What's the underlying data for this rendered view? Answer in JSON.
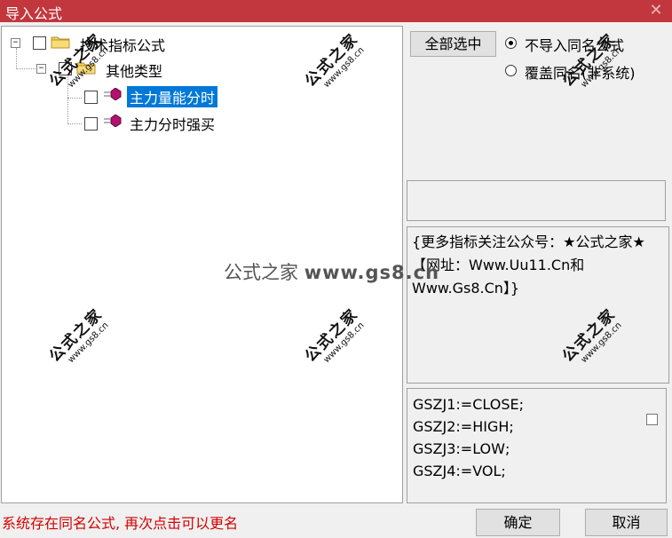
{
  "window": {
    "title": "导入公式",
    "close_glyph": "✕"
  },
  "tree": {
    "root": {
      "label": "技术指标公式",
      "expander": "−"
    },
    "group": {
      "label": "其他类型",
      "expander": "−"
    },
    "items": [
      {
        "label": "主力量能分时",
        "selected": true
      },
      {
        "label": "主力分时强买",
        "selected": false
      }
    ]
  },
  "buttons": {
    "select_all": "全部选中",
    "ok": "确定",
    "cancel": "取消"
  },
  "options": {
    "no_import_same_name": "不导入同名公式",
    "overwrite_same_name": "覆盖同名(非系统)",
    "selected": "no_import_same_name"
  },
  "description": "{更多指标关注公众号：★公式之家★ 【网址：Www.Uu11.Cn和Www.Gs8.Cn】}",
  "code_lines": [
    "GSZJ1:=CLOSE;",
    "GSZJ2:=HIGH;",
    "GSZJ3:=LOW;",
    "GSZJ4:=VOL;"
  ],
  "status_message": "系统存在同名公式, 再次点击可以更名",
  "watermark": {
    "brand": "公式之家",
    "url": "www.gs8.cn",
    "center_url": "www.gs8.cn"
  },
  "colors": {
    "titlebar": "#c1373d",
    "selection": "#0078d7",
    "status": "#d40000"
  }
}
